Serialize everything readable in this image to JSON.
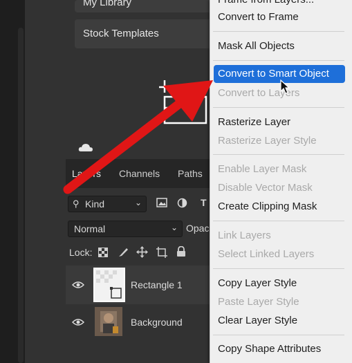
{
  "library": {
    "my_library": "My Library",
    "stock_templates": "Stock Templates"
  },
  "layers_panel": {
    "tabs": [
      "Layers",
      "Channels",
      "Paths"
    ],
    "filter_kind": "Kind",
    "filter_type_letter": "T",
    "blend_mode": "Normal",
    "opacity_label": "Opac",
    "lock_label": "Lock:",
    "layers": [
      {
        "name": "Rectangle 1"
      },
      {
        "name": "Background"
      }
    ]
  },
  "context_menu": {
    "items": [
      {
        "label": "Frame from Layers...",
        "enabled": true,
        "highlighted": false
      },
      {
        "label": "Convert to Frame",
        "enabled": true,
        "highlighted": false
      },
      {
        "label": "Mask All Objects",
        "enabled": true,
        "highlighted": false
      },
      {
        "label": "Convert to Smart Object",
        "enabled": true,
        "highlighted": true
      },
      {
        "label": "Convert to Layers",
        "enabled": false,
        "highlighted": false
      },
      {
        "label": "Rasterize Layer",
        "enabled": true,
        "highlighted": false
      },
      {
        "label": "Rasterize Layer Style",
        "enabled": false,
        "highlighted": false
      },
      {
        "label": "Enable Layer Mask",
        "enabled": false,
        "highlighted": false
      },
      {
        "label": "Disable Vector Mask",
        "enabled": false,
        "highlighted": false
      },
      {
        "label": "Create Clipping Mask",
        "enabled": true,
        "highlighted": false
      },
      {
        "label": "Link Layers",
        "enabled": false,
        "highlighted": false
      },
      {
        "label": "Select Linked Layers",
        "enabled": false,
        "highlighted": false
      },
      {
        "label": "Copy Layer Style",
        "enabled": true,
        "highlighted": false
      },
      {
        "label": "Paste Layer Style",
        "enabled": false,
        "highlighted": false
      },
      {
        "label": "Clear Layer Style",
        "enabled": true,
        "highlighted": false
      },
      {
        "label": "Copy Shape Attributes",
        "enabled": true,
        "highlighted": false
      }
    ]
  },
  "colors": {
    "menu_highlight": "#1e6fd9",
    "annotation_arrow": "#e01616"
  }
}
